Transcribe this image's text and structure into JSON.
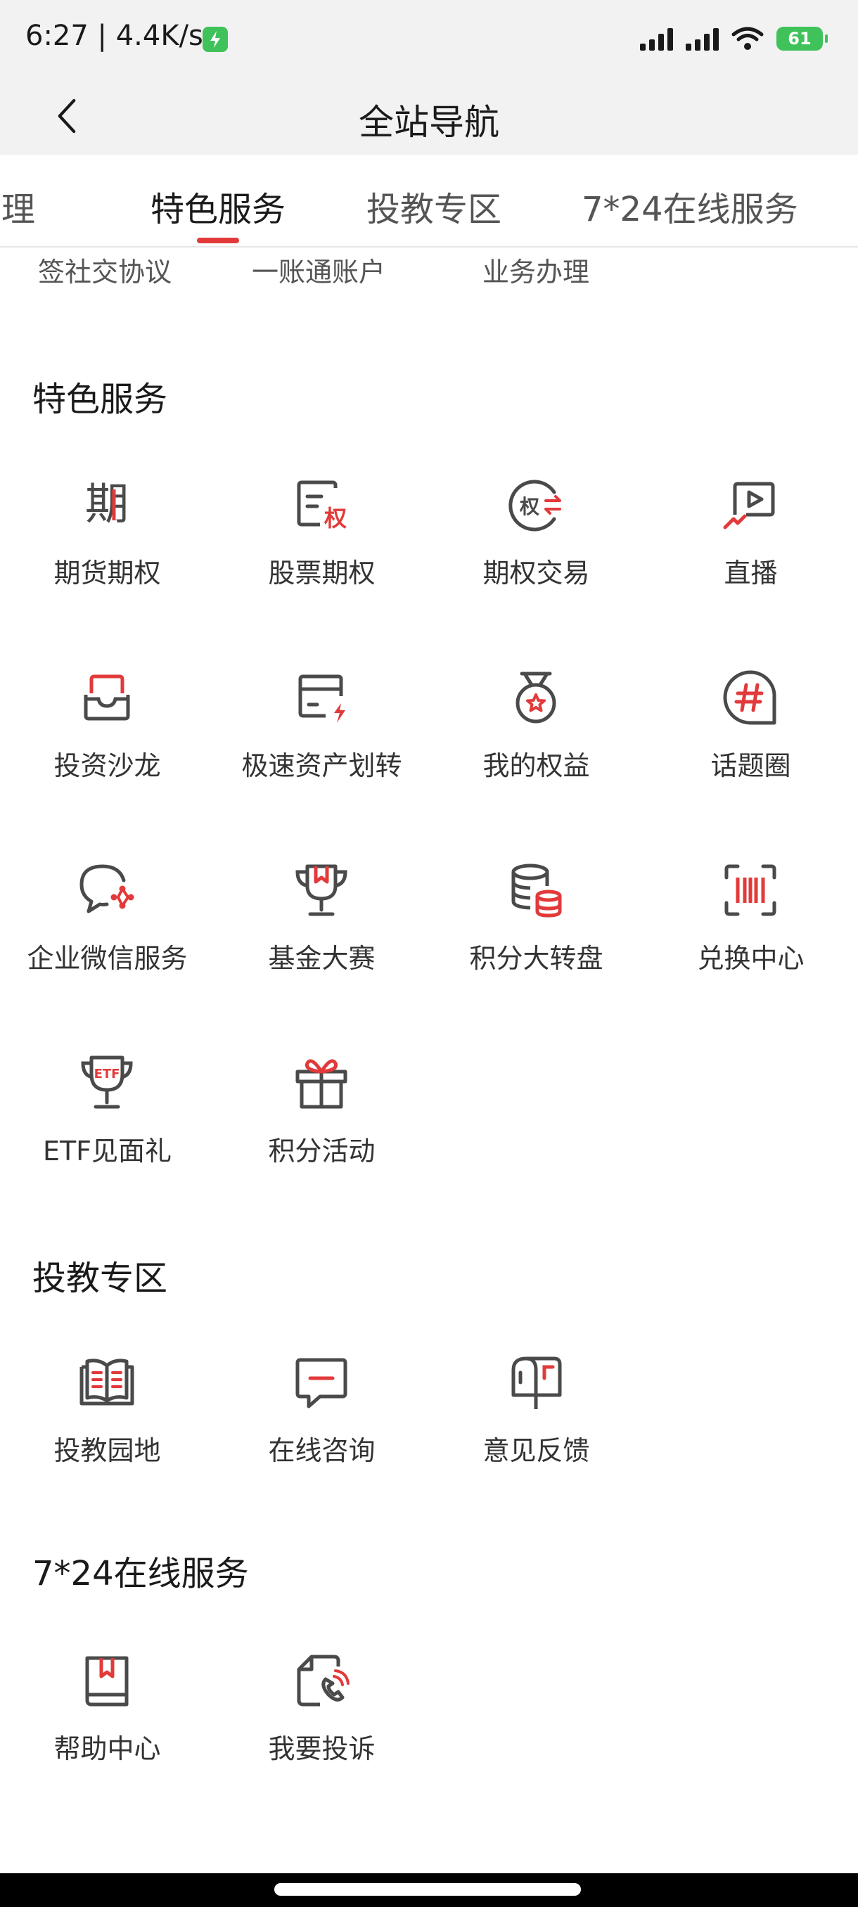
{
  "status": {
    "time_speed": "6:27 | 4.4K/s",
    "battery": "61"
  },
  "header": {
    "title": "全站导航"
  },
  "tabs": [
    {
      "label": "办理"
    },
    {
      "label": "特色服务"
    },
    {
      "label": "投教专区"
    },
    {
      "label": "7*24在线服务"
    }
  ],
  "partial_row": [
    "签社交协议",
    "一账通账户",
    "业务办理"
  ],
  "sections": {
    "special": {
      "title": "特色服务",
      "items": [
        {
          "label": "期货期权",
          "icon": "futures-options-icon"
        },
        {
          "label": "股票期权",
          "icon": "stock-options-icon"
        },
        {
          "label": "期权交易",
          "icon": "options-trade-icon"
        },
        {
          "label": "直播",
          "icon": "live-stream-icon"
        },
        {
          "label": "投资沙龙",
          "icon": "investment-salon-icon"
        },
        {
          "label": "极速资产划转",
          "icon": "fast-transfer-icon"
        },
        {
          "label": "我的权益",
          "icon": "medal-icon"
        },
        {
          "label": "话题圈",
          "icon": "hashtag-icon"
        },
        {
          "label": "企业微信服务",
          "icon": "wechat-work-icon"
        },
        {
          "label": "基金大赛",
          "icon": "trophy-icon"
        },
        {
          "label": "积分大转盘",
          "icon": "coins-icon"
        },
        {
          "label": "兑换中心",
          "icon": "barcode-scan-icon"
        },
        {
          "label": "ETF见面礼",
          "icon": "etf-cup-icon"
        },
        {
          "label": "积分活动",
          "icon": "gift-icon"
        }
      ]
    },
    "education": {
      "title": "投教专区",
      "items": [
        {
          "label": "投教园地",
          "icon": "book-icon"
        },
        {
          "label": "在线咨询",
          "icon": "chat-icon"
        },
        {
          "label": "意见反馈",
          "icon": "mailbox-icon"
        }
      ]
    },
    "online": {
      "title": "7*24在线服务",
      "items": [
        {
          "label": "帮助中心",
          "icon": "help-book-icon"
        },
        {
          "label": "我要投诉",
          "icon": "complaint-phone-icon"
        }
      ]
    }
  },
  "colors": {
    "accent": "#e23a3a",
    "icon_gray": "#4a4a4a",
    "battery_green": "#3fc25a"
  }
}
